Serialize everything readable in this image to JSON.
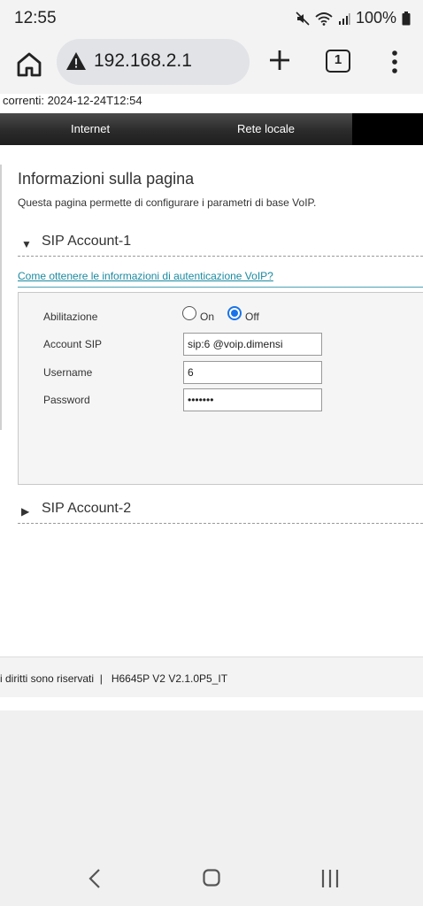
{
  "status_bar": {
    "time": "12:55",
    "battery": "100%",
    "icons": [
      "mute-icon",
      "wifi-icon",
      "signal-icon",
      "battery-icon"
    ]
  },
  "browser": {
    "url": "192.168.2.1",
    "tab_count": "1",
    "icons": [
      "home-icon",
      "warning-icon",
      "plus-icon",
      "tab-switcher-icon",
      "more-vert-icon"
    ]
  },
  "page": {
    "current_time": "correnti: 2024-12-24T12:54",
    "nav": [
      "Internet",
      "Rete locale"
    ],
    "title": "Informazioni sulla pagina",
    "description": "Questa pagina permette di configurare i parametri di base VoIP.",
    "account1": {
      "title": "SIP Account-1",
      "expanded": true,
      "help_link": "Come ottenere le informazioni di autenticazione VoIP?",
      "labels": {
        "enable": "Abilitazione",
        "account": "Account SIP",
        "username": "Username",
        "password": "Password"
      },
      "radio_on": "On",
      "radio_off": "Off",
      "selected": "Off",
      "account_value": "sip:6       @voip.dimensi",
      "username_value": "6",
      "password_value": "•••••••"
    },
    "account2": {
      "title": "SIP Account-2",
      "expanded": false
    },
    "footer": "i diritti sono riservati  |   H6645P V2 V2.1.0P5_IT"
  },
  "colors": {
    "accent": "#1a73e8",
    "link": "#1a8aa0",
    "nav_bar": "#2b2b2b"
  }
}
